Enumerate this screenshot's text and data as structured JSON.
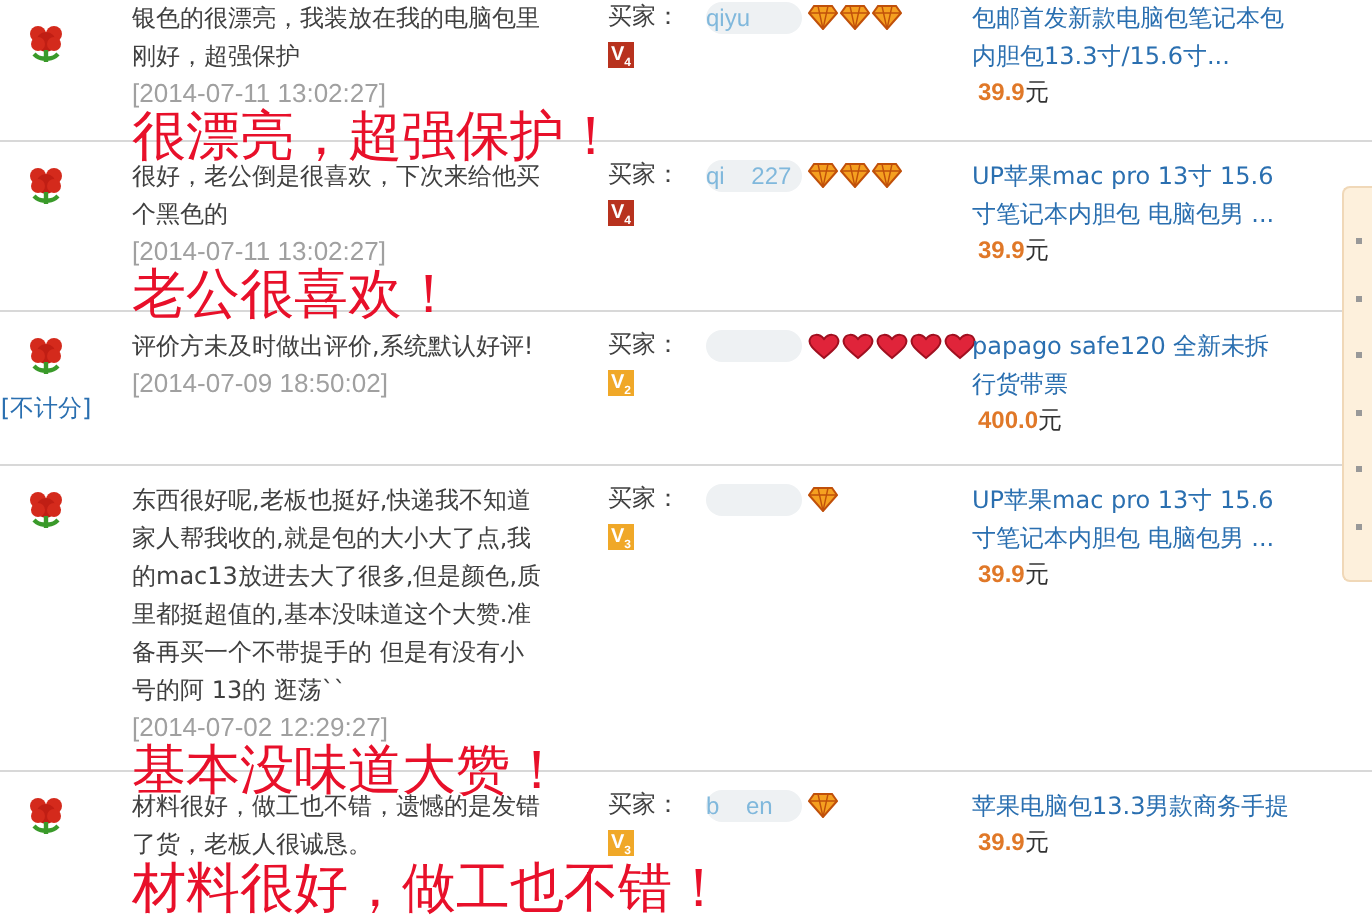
{
  "reviews": [
    {
      "comment": "银色的很漂亮，我装放在我的电脑包里刚好，超强保护",
      "time": "[2014-07-11 13:02:27]",
      "annotation": "很漂亮，超强保护！",
      "buyer_label": "买家：",
      "buyer": "qiyu",
      "rank_icons": [
        {
          "kind": "diamond"
        },
        {
          "kind": "diamond"
        },
        {
          "kind": "diamond"
        }
      ],
      "vip": {
        "label": "V$_{4}$",
        "color": "#b8321e"
      },
      "product": "包邮首发新款电脑包笔记本包内胆包13.3寸/15.6寸...",
      "price": "39.9",
      "currency": "元"
    },
    {
      "comment": "很好，老公倒是很喜欢，下次来给他买个黑色的",
      "time": "[2014-07-11 13:02:27]",
      "annotation": "老公很喜欢！",
      "buyer_label": "买家：",
      "buyer": "qi    227",
      "rank_icons": [
        {
          "kind": "diamond"
        },
        {
          "kind": "diamond"
        },
        {
          "kind": "diamond"
        }
      ],
      "vip": {
        "label": "V$_{4}$",
        "color": "#b8321e"
      },
      "product": "UP苹果mac pro 13寸 15.6寸笔记本内胆包 电脑包男 ...",
      "price": "39.9",
      "currency": "元"
    },
    {
      "comment": "评价方未及时做出评价,系统默认好评!",
      "time": "[2014-07-09 18:50:02]",
      "note": "[不计分]",
      "buyer_label": "买家：",
      "rank_icons": [
        {
          "kind": "heart"
        },
        {
          "kind": "heart"
        },
        {
          "kind": "heart"
        },
        {
          "kind": "heart"
        },
        {
          "kind": "heart"
        }
      ],
      "vip": {
        "label": "V$_{2}$",
        "color": "#f0a828"
      },
      "product": "papago safe120 全新未拆行货带票",
      "price": "400.0",
      "currency": "元"
    },
    {
      "comment": "东西很好呢,老板也挺好,快递我不知道家人帮我收的,就是包的大小大了点,我的mac13放进去大了很多,但是颜色,质里都挺超值的,基本没味道这个大赞.准备再买一个不带提手的 但是有没有小号的阿 13的 逛荡``",
      "time": "[2014-07-02 12:29:27]",
      "annotation": "基本没味道大赞！",
      "buyer_label": "买家：",
      "rank_icons": [
        {
          "kind": "diamond"
        }
      ],
      "vip": {
        "label": "V$_{3}$",
        "color": "#f0a828"
      },
      "product": "UP苹果mac pro 13寸 15.6寸笔记本内胆包 电脑包男 ...",
      "price": "39.9",
      "currency": "元"
    },
    {
      "comment": "材料很好，做工也不错，遗憾的是发错了货，老板人很诚恳。",
      "annotation": "材料很好，做工也不错！",
      "buyer_label": "买家：",
      "buyer": "b    en",
      "rank_icons": [
        {
          "kind": "diamond"
        }
      ],
      "vip": {
        "label": "V$_{3}$",
        "color": "#f0a828"
      },
      "product": "苹果电脑包13.3男款商务手提",
      "price": "39.9",
      "currency": "元"
    }
  ]
}
